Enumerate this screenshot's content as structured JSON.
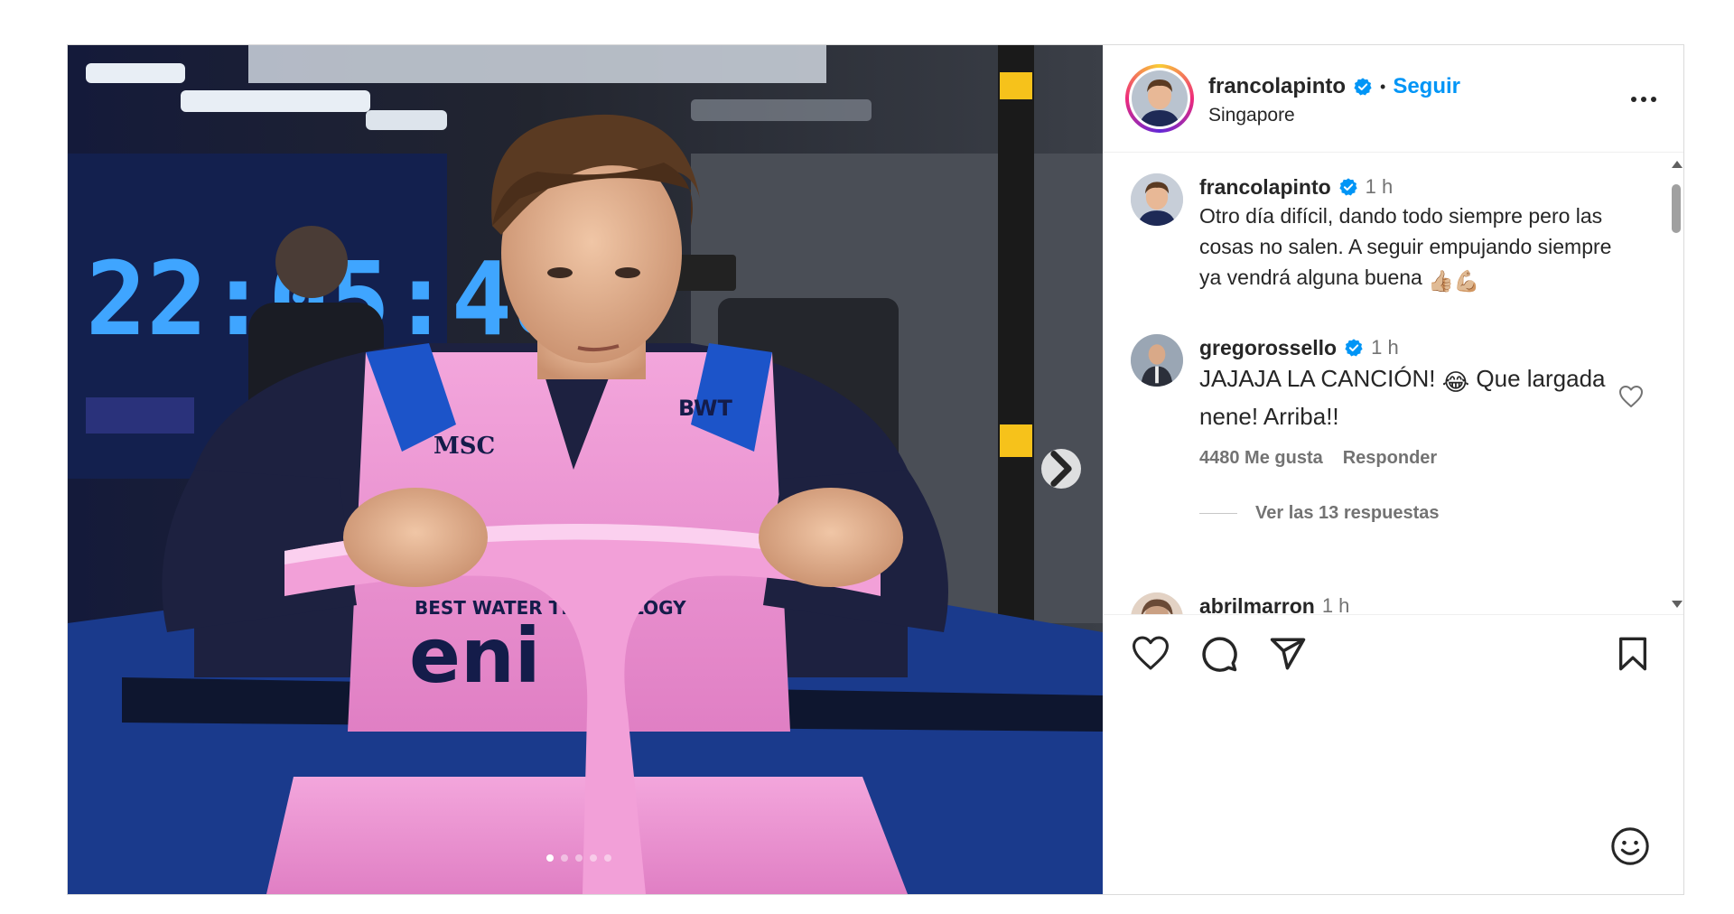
{
  "post": {
    "author": {
      "username": "francolapinto",
      "verified": true,
      "follow_label": "Seguir",
      "separator": "•",
      "location": "Singapore"
    },
    "more_icon": "more-horizontal-icon",
    "carousel": {
      "slide_count": 5,
      "active_index": 0,
      "next_icon": "chevron-right-icon"
    },
    "photo_text": {
      "clock": "22:05:48",
      "sponsor_main": "eni",
      "sponsor_water": "BEST WATER TECHNOLOGY",
      "sponsor_msc": "MSC",
      "sponsor_bwt": "BWT"
    }
  },
  "comments": [
    {
      "username": "francolapinto",
      "verified": true,
      "time": "1 h",
      "text": "Otro día difícil, dando todo siempre pero las cosas no salen. A seguir empujando siempre ya vendrá alguna buena",
      "emojis": [
        "👍🏼",
        "💪🏼"
      ]
    },
    {
      "username": "gregorossello",
      "verified": true,
      "time": "1 h",
      "text_before": "JAJAJA LA CANCIÓN!",
      "emoji": "😂",
      "text_after": "Que largada nene! Arriba!!",
      "likes": "4480 Me gusta",
      "reply_label": "Responder",
      "view_replies": "Ver las 13 respuestas"
    },
    {
      "username": "abrilmarron",
      "time": "1 h"
    }
  ],
  "actions": {
    "like_icon": "heart-icon",
    "comment_icon": "comment-icon",
    "share_icon": "send-icon",
    "save_icon": "bookmark-icon",
    "emoji_icon": "smiley-icon"
  }
}
